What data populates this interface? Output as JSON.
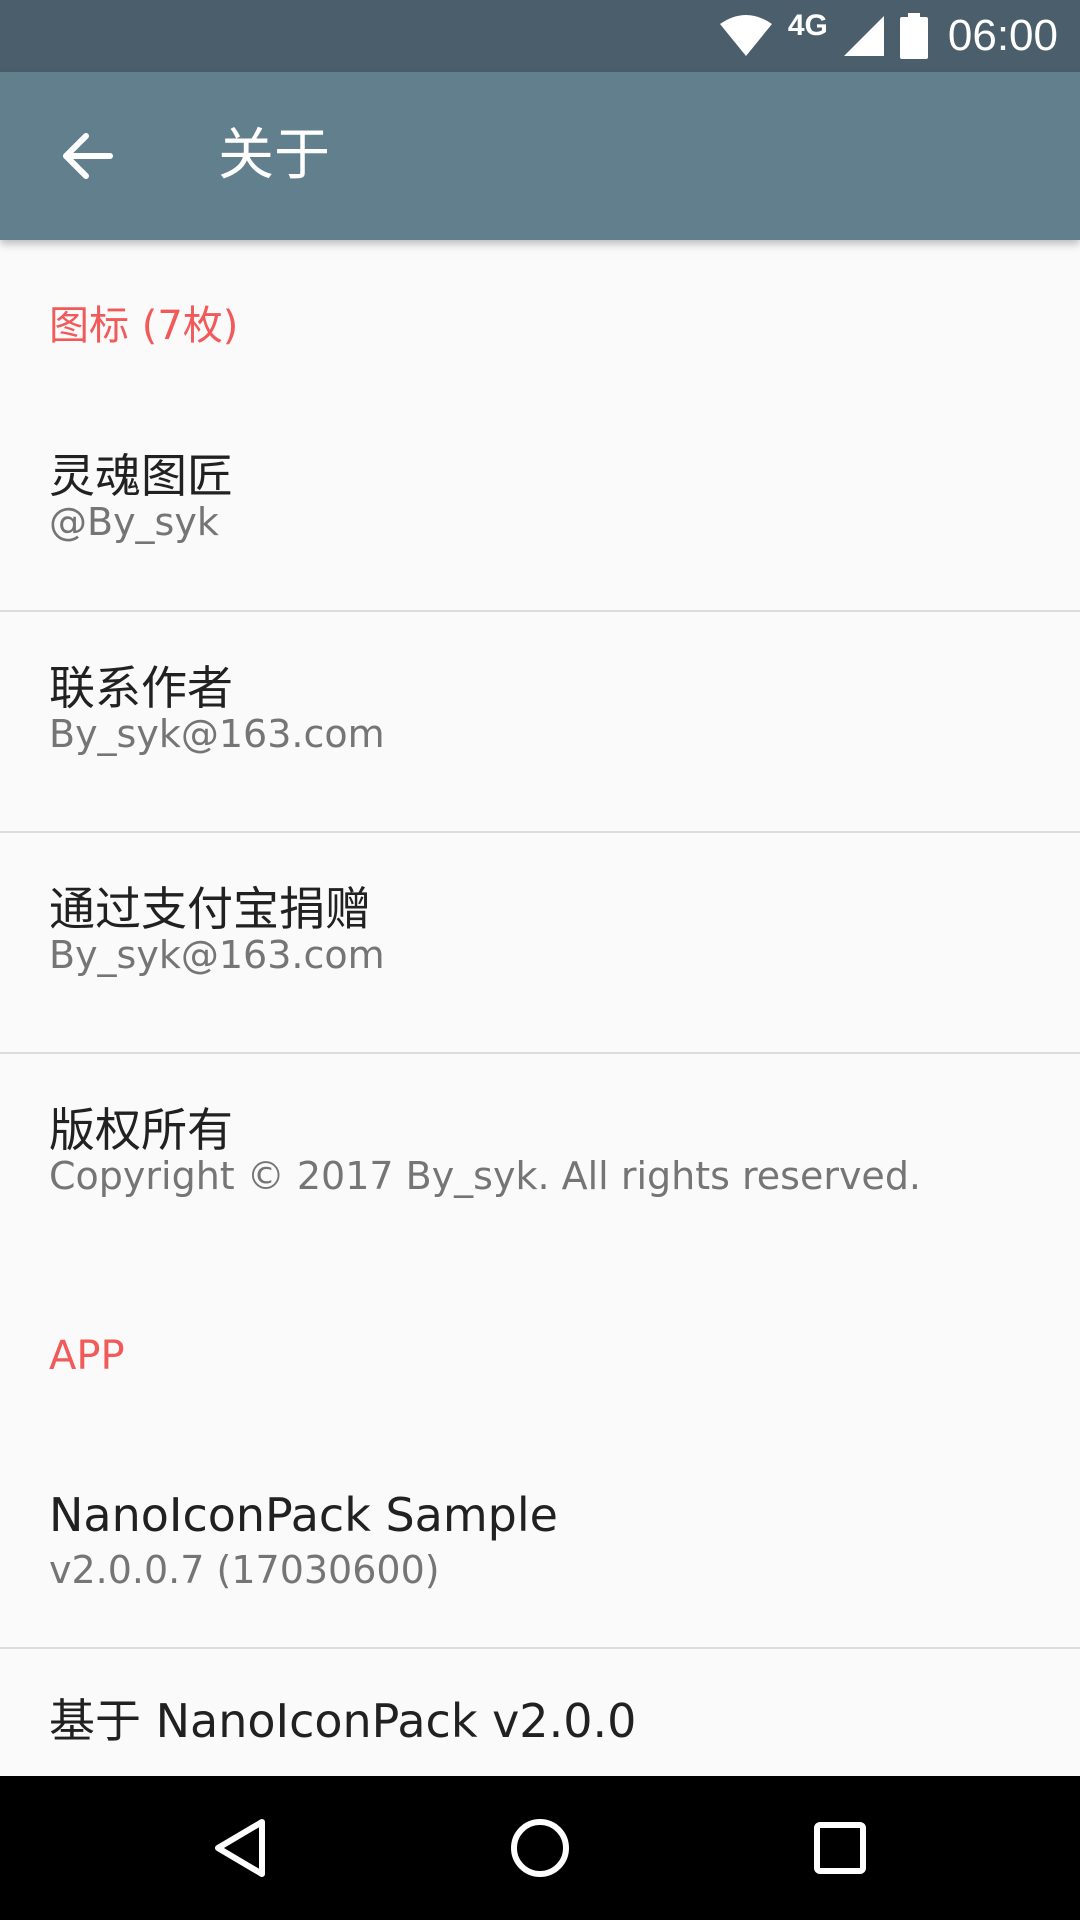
{
  "status_bar": {
    "network": "4G",
    "time": "06:00"
  },
  "app_bar": {
    "title": "关于",
    "back_icon": "arrow-back-icon"
  },
  "sections": [
    {
      "header": "图标 (7枚)",
      "items": [
        {
          "title": "灵魂图匠",
          "subtitle": "@By_syk"
        },
        {
          "title": "联系作者",
          "subtitle": "By_syk@163.com"
        },
        {
          "title": "通过支付宝捐赠",
          "subtitle": "By_syk@163.com"
        },
        {
          "title": "版权所有",
          "subtitle": "Copyright © 2017 By_syk. All rights reserved."
        }
      ]
    },
    {
      "header": "APP",
      "items": [
        {
          "title": "NanoIconPack Sample",
          "subtitle": "v2.0.0.7 (17030600)"
        },
        {
          "title": "基于 NanoIconPack v2.0.0",
          "subtitle": ""
        }
      ]
    }
  ],
  "nav_bar": {
    "back_icon": "nav-back-triangle-icon",
    "home_icon": "nav-home-circle-icon",
    "recents_icon": "nav-recents-square-icon"
  },
  "colors": {
    "status_bar": "#4a5f6b",
    "app_bar": "#627f8e",
    "accent": "#f25a5a",
    "background": "#fafafa"
  }
}
